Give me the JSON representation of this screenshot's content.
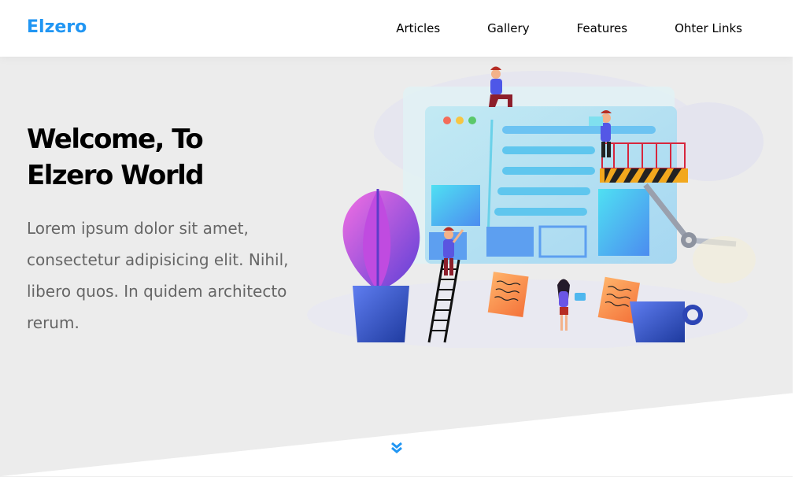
{
  "header": {
    "logo": "Elzero",
    "nav": [
      "Articles",
      "Gallery",
      "Features",
      "Ohter Links"
    ]
  },
  "landing": {
    "title": "Welcome, To Elzero World",
    "description": "Lorem ipsum dolor sit amet, consectetur adipisicing elit. Nihil, libero quos. In quidem architecto rerum.",
    "illustration_icon": "team-building-website-illustration",
    "scroll_icon": "double-chevron-down-icon"
  },
  "colors": {
    "brand": "#2196f3",
    "background": "#ececec",
    "header": "#ffffff",
    "text": "#000000",
    "muted": "#666666"
  }
}
